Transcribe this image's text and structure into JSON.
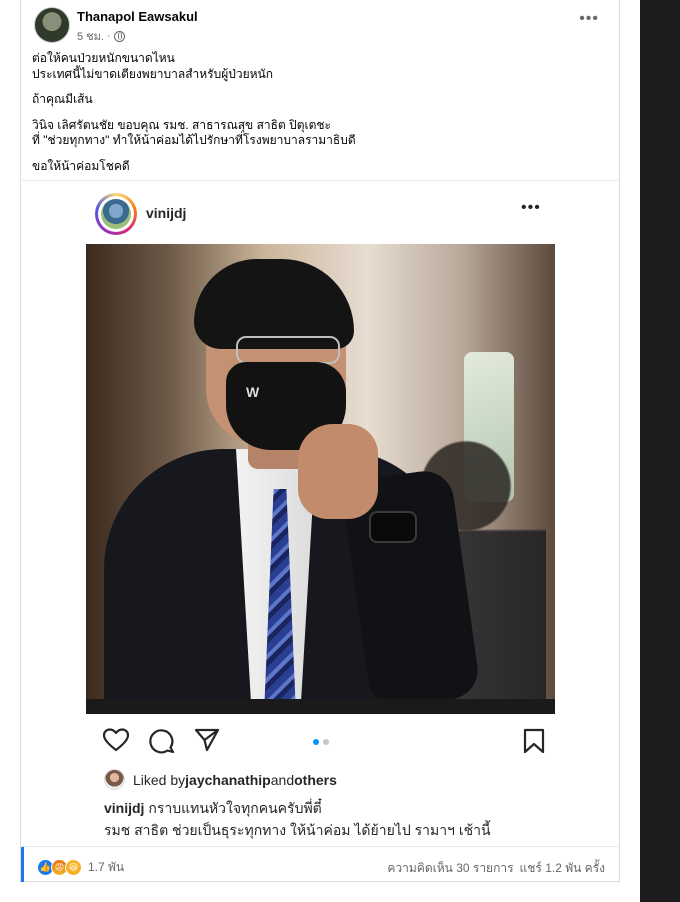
{
  "post": {
    "author": "Thanapol Eawsakul",
    "time": "5 ชม.",
    "separator": "·",
    "more_icon": "more-horizontal-icon",
    "caption": [
      "ต่อให้คนป่วยหนักขนาดไหน",
      "ประเทศนี้ไม่ขาดเตียงพยาบาลสำหรับผู้ป่วยหนัก",
      "ถ้าคุณมีเส้น",
      "วินิจ เลิศรัตนชัย ขอบคุณ รมช. สาธารณสุข  สาธิต ปิตุเตชะ",
      " ที่ \"ช่วยทุกทาง\" ทำให้น้าค่อมได้ไปรักษาที่โรงพยาบาลรามาธิบดี",
      "ขอให้น้าค่อมโชคดี"
    ]
  },
  "embed": {
    "username": "vinijdj",
    "photo_alt": "man in suit wearing black face mask",
    "mask_logo": "W",
    "liked_prefix": "Liked by ",
    "liked_user": "jaychanathip",
    "liked_and": " and ",
    "liked_others": "others",
    "caption_user": "vinijdj",
    "caption_line1": " กราบแทนหัวใจทุกคนครับพี่ตี๋",
    "caption_line2": "รมช สาธิต ช่วยเป็นธุระทุกทาง ให้น้าค่อม ได้ย้ายไป รามาฯ เช้านี้",
    "carousel": {
      "count": 2,
      "active": 0
    }
  },
  "footer": {
    "reaction_count": "1.7 พัน",
    "comments": "ความคิดเห็น 30 รายการ",
    "shares": "แชร์ 1.2 พัน ครั้ง"
  },
  "colors": {
    "fb_blue": "#1877f2",
    "ig_dot_active": "#0095f6",
    "text_secondary": "#65676b"
  }
}
